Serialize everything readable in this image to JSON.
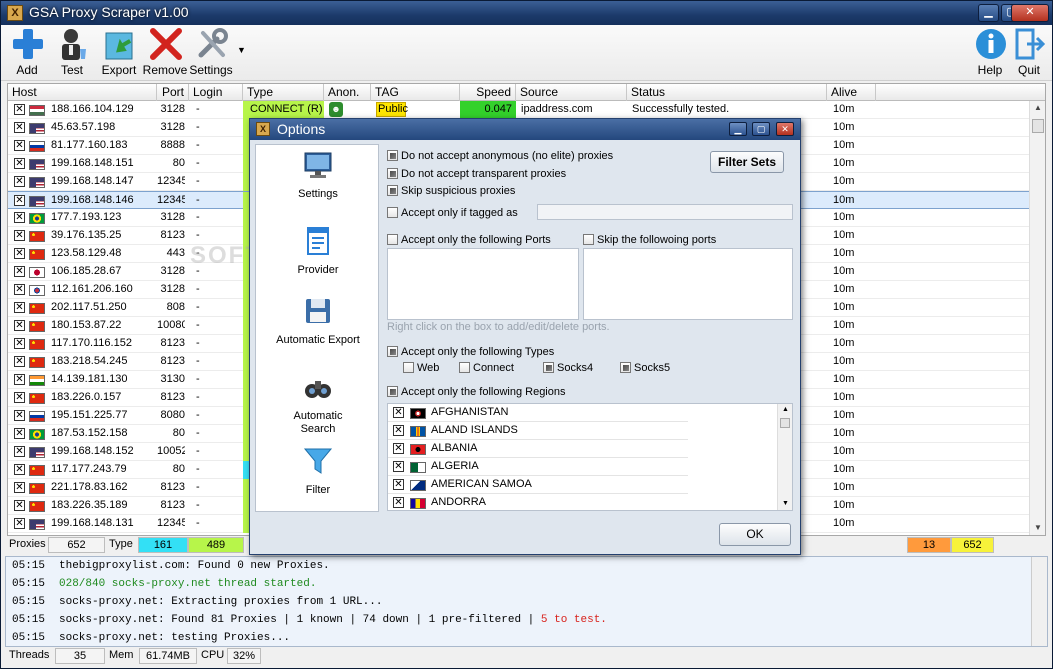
{
  "window": {
    "title": "GSA Proxy Scraper v1.00",
    "min": "▁",
    "max": "▢",
    "close": "✕"
  },
  "toolbar": {
    "add": "Add",
    "test": "Test",
    "export": "Export",
    "remove": "Remove",
    "settings": "Settings",
    "help": "Help",
    "quit": "Quit"
  },
  "grid": {
    "headers": [
      "Host",
      "Port",
      "Login",
      "Type",
      "Anon.",
      "TAG",
      "Speed",
      "Source",
      "Status",
      "Alive"
    ],
    "first_row": {
      "type": "CONNECT (R)",
      "tag": "Public",
      "speed": "0.047",
      "source": "ipaddress.com",
      "status": "Successfully tested."
    },
    "rows": [
      {
        "host": "188.166.104.129",
        "port": "3128",
        "login": "-",
        "alive": "10m",
        "flag": "hu",
        "type_color": "#b7f54a"
      },
      {
        "host": "45.63.57.198",
        "port": "3128",
        "login": "-",
        "alive": "10m",
        "flag": "us",
        "type_color": "#b7f54a"
      },
      {
        "host": "81.177.160.183",
        "port": "8888",
        "login": "-",
        "alive": "10m",
        "flag": "ru",
        "type_color": "#b7f54a"
      },
      {
        "host": "199.168.148.151",
        "port": "80",
        "login": "-",
        "alive": "10m",
        "flag": "us",
        "type_color": "#b7f54a"
      },
      {
        "host": "199.168.148.147",
        "port": "12345",
        "login": "-",
        "alive": "10m",
        "flag": "us",
        "type_color": "#b7f54a"
      },
      {
        "host": "199.168.148.146",
        "port": "12345",
        "login": "-",
        "alive": "10m",
        "flag": "us",
        "type_color": "#b7f54a",
        "selected": true
      },
      {
        "host": "177.7.193.123",
        "port": "3128",
        "login": "-",
        "alive": "10m",
        "flag": "br",
        "type_color": "#b7f54a"
      },
      {
        "host": "39.176.135.25",
        "port": "8123",
        "login": "-",
        "alive": "10m",
        "flag": "cn",
        "type_color": "#b7f54a"
      },
      {
        "host": "123.58.129.48",
        "port": "443",
        "login": "-",
        "alive": "10m",
        "flag": "cn",
        "type_color": "#b7f54a"
      },
      {
        "host": "106.185.28.67",
        "port": "3128",
        "login": "-",
        "alive": "10m",
        "flag": "jp",
        "type_color": "#b7f54a"
      },
      {
        "host": "112.161.206.160",
        "port": "3128",
        "login": "-",
        "alive": "10m",
        "flag": "kr",
        "type_color": "#b7f54a"
      },
      {
        "host": "202.117.51.250",
        "port": "808",
        "login": "-",
        "alive": "10m",
        "flag": "cn",
        "type_color": "#b7f54a"
      },
      {
        "host": "180.153.87.22",
        "port": "10080",
        "login": "-",
        "alive": "10m",
        "flag": "cn",
        "type_color": "#b7f54a"
      },
      {
        "host": "117.170.116.152",
        "port": "8123",
        "login": "-",
        "alive": "10m",
        "flag": "cn",
        "type_color": "#b7f54a"
      },
      {
        "host": "183.218.54.245",
        "port": "8123",
        "login": "-",
        "alive": "10m",
        "flag": "cn",
        "type_color": "#b7f54a"
      },
      {
        "host": "14.139.181.130",
        "port": "3130",
        "login": "-",
        "alive": "10m",
        "flag": "in",
        "type_color": "#b7f54a"
      },
      {
        "host": "183.226.0.157",
        "port": "8123",
        "login": "-",
        "alive": "10m",
        "flag": "cn",
        "type_color": "#b7f54a"
      },
      {
        "host": "195.151.225.77",
        "port": "8080",
        "login": "-",
        "alive": "10m",
        "flag": "ru",
        "type_color": "#b7f54a"
      },
      {
        "host": "187.53.152.158",
        "port": "80",
        "login": "-",
        "alive": "10m",
        "flag": "br",
        "type_color": "#b7f54a"
      },
      {
        "host": "199.168.148.152",
        "port": "10052",
        "login": "-",
        "alive": "10m",
        "flag": "us",
        "type_color": "#b7f54a"
      },
      {
        "host": "117.177.243.79",
        "port": "80",
        "login": "-",
        "alive": "10m",
        "flag": "cn",
        "type_color": "#33e0f5"
      },
      {
        "host": "221.178.83.162",
        "port": "8123",
        "login": "-",
        "alive": "10m",
        "flag": "cn",
        "type_color": "#b7f54a"
      },
      {
        "host": "183.226.35.189",
        "port": "8123",
        "login": "-",
        "alive": "10m",
        "flag": "cn",
        "type_color": "#b7f54a"
      },
      {
        "host": "199.168.148.131",
        "port": "12345",
        "login": "-",
        "alive": "10m",
        "flag": "us",
        "type_color": "#b7f54a"
      }
    ]
  },
  "stats": {
    "proxies_label": "Proxies",
    "proxies": "652",
    "type_label": "Type",
    "type_a": "161",
    "type_b": "489",
    "right_a": "13",
    "right_b": "652"
  },
  "log": [
    {
      "time": "05:15",
      "msg": "thebigproxylist.com: Found 0 new Proxies.",
      "color": "#000"
    },
    {
      "time": "05:15",
      "msg": "028/840 socks-proxy.net thread started.",
      "color": "#1f8a1f"
    },
    {
      "time": "05:15",
      "msg": "socks-proxy.net: Extracting proxies from 1 URL...",
      "color": "#000"
    },
    {
      "time": "05:15",
      "msg": "socks-proxy.net: Found 81 Proxies | 1 known | 74 down | 1 pre-filtered | ",
      "extra": "5 to test.",
      "color": "#000"
    },
    {
      "time": "05:15",
      "msg": "socks-proxy.net: testing Proxies...",
      "color": "#000"
    }
  ],
  "status": {
    "threads_label": "Threads",
    "threads": "35",
    "mem_label": "Mem",
    "mem": "61.74MB",
    "cpu_label": "CPU",
    "cpu": "32%"
  },
  "dialog": {
    "title": "Options",
    "sidebar": [
      "Settings",
      "Provider",
      "Automatic Export",
      "Automatic Search",
      "Filter"
    ],
    "opts": {
      "no_anon": "Do not accept anonymous (no elite) proxies",
      "no_transparent": "Do not accept transparent proxies",
      "skip_suspicious": "Skip suspicious proxies",
      "accept_tagged": "Accept only if tagged as",
      "accept_ports": "Accept only the following Ports",
      "skip_ports": "Skip the followoing ports",
      "ports_hint": "Right click on the box to add/edit/delete ports.",
      "accept_types": "Accept only the following Types",
      "web": "Web",
      "connect": "Connect",
      "socks4": "Socks4",
      "socks5": "Socks5",
      "accept_regions": "Accept only the following Regions"
    },
    "filter_sets": "Filter Sets",
    "ok": "OK",
    "regions": [
      "AFGHANISTAN",
      "ALAND ISLANDS",
      "ALBANIA",
      "ALGERIA",
      "AMERICAN SAMOA",
      "ANDORRA"
    ]
  },
  "watermark": "SOFTPEDIA"
}
